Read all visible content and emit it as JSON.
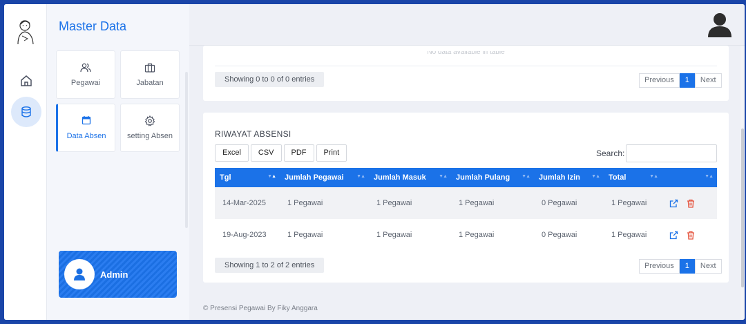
{
  "sidebar": {
    "title": "Master Data",
    "tiles": [
      {
        "label": "Pegawai",
        "icon": "users-icon"
      },
      {
        "label": "Jabatan",
        "icon": "briefcase-icon"
      },
      {
        "label": "Data Absen",
        "icon": "calendar-icon"
      },
      {
        "label": "setting Absen",
        "icon": "gear-icon"
      }
    ],
    "admin_name": "Admin"
  },
  "top_table": {
    "empty_text": "No data available in table",
    "info": "Showing 0 to 0 of 0 entries",
    "pager": {
      "prev": "Previous",
      "page": "1",
      "next": "Next"
    }
  },
  "riwayat": {
    "title": "RIWAYAT ABSENSI",
    "buttons": [
      "Excel",
      "CSV",
      "PDF",
      "Print"
    ],
    "search_label": "Search:",
    "columns": [
      "Tgl",
      "Jumlah Pegawai",
      "Jumlah Masuk",
      "Jumlah Pulang",
      "Jumlah Izin",
      "Total",
      ""
    ],
    "rows": [
      [
        "14-Mar-2025",
        "1 Pegawai",
        "1 Pegawai",
        "1 Pegawai",
        "0 Pegawai",
        "1 Pegawai"
      ],
      [
        "19-Aug-2023",
        "1 Pegawai",
        "1 Pegawai",
        "1 Pegawai",
        "0 Pegawai",
        "1 Pegawai"
      ]
    ],
    "info": "Showing 1 to 2 of 2 entries",
    "pager": {
      "prev": "Previous",
      "page": "1",
      "next": "Next"
    }
  },
  "footer": "© Presensi Pegawai By Fiky Anggara",
  "colors": {
    "accent": "#1b72e8",
    "delete": "#e5533d"
  }
}
